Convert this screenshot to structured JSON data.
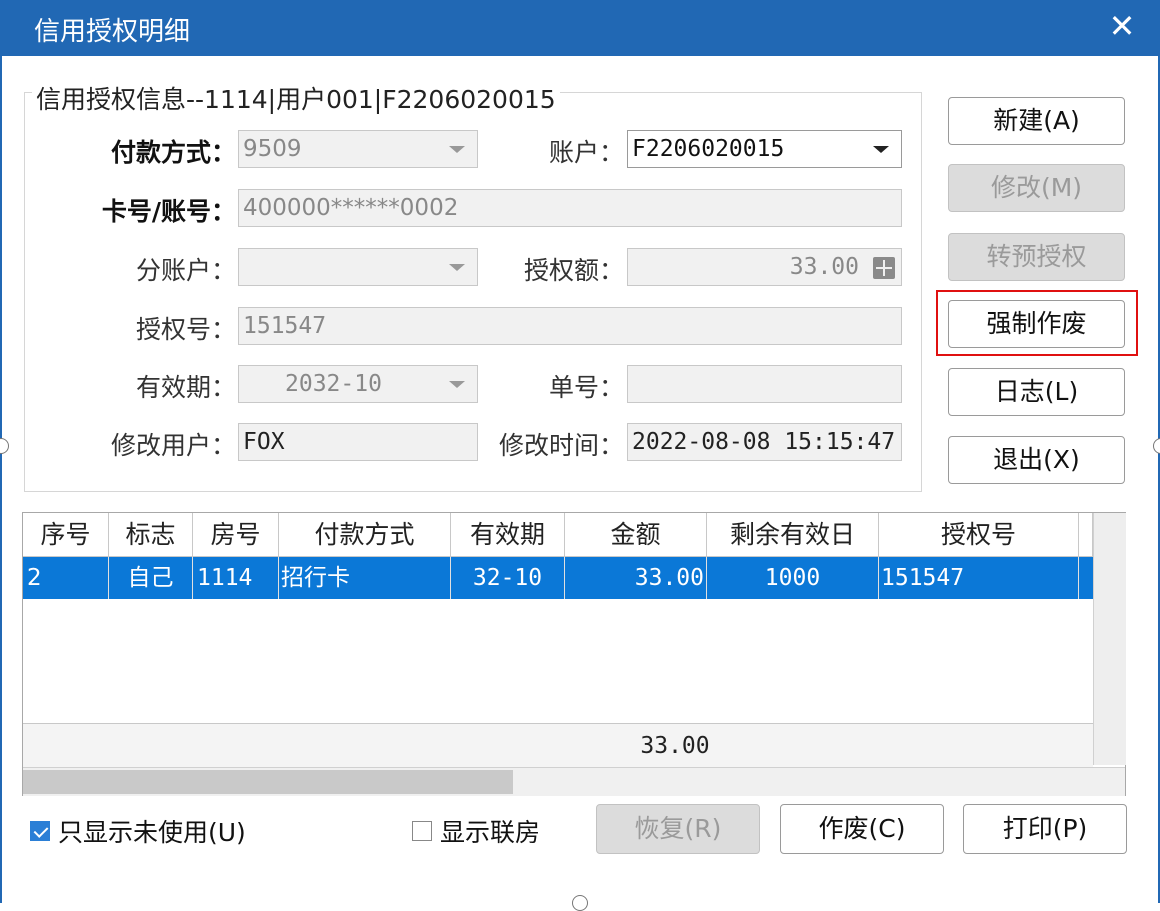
{
  "window": {
    "title": "信用授权明细",
    "close_glyph": "✕"
  },
  "group_title": "信用授权信息--1114|用户001|F2206020015",
  "fields": {
    "payment_method": {
      "label": "付款方式：",
      "value": "9509"
    },
    "account": {
      "label": "账户：",
      "value": "F2206020015"
    },
    "card_no": {
      "label": "卡号/账号：",
      "value": "400000******0002"
    },
    "sub_account": {
      "label": "分账户：",
      "value": ""
    },
    "auth_amount": {
      "label": "授权额：",
      "value": "33.00"
    },
    "auth_no": {
      "label": "授权号：",
      "value": "151547"
    },
    "expiry": {
      "label": "有效期：",
      "value": "2032-10"
    },
    "doc_no": {
      "label": "单号：",
      "value": ""
    },
    "modified_by": {
      "label": "修改用户：",
      "value": "FOX"
    },
    "modified_time": {
      "label": "修改时间：",
      "value": "2022-08-08 15:15:47"
    }
  },
  "side_buttons": {
    "new": "新建(A)",
    "edit": "修改(M)",
    "to_preauth": "转预授权",
    "force_void": "强制作废",
    "log": "日志(L)",
    "exit": "退出(X)"
  },
  "table": {
    "columns": [
      "序号",
      "标志",
      "房号",
      "付款方式",
      "有效期",
      "金额",
      "剩余有效日",
      "授权号"
    ],
    "rows": [
      {
        "seq": "2",
        "flag": "自己",
        "room": "1114",
        "method": "招行卡",
        "expiry": "32-10",
        "amount": "33.00",
        "days": "1000",
        "auth_no": "151547"
      }
    ],
    "total_amount": "33.00"
  },
  "bottom": {
    "only_unused": {
      "label": "只显示未使用(U)",
      "checked": true
    },
    "show_linked": {
      "label": "显示联房",
      "checked": false
    },
    "restore": "恢复(R)",
    "void": "作废(C)",
    "print": "打印(P)"
  },
  "colors": {
    "titlebar": "#2168b4",
    "selection": "#0b78d7",
    "highlight_border": "#e01010"
  }
}
